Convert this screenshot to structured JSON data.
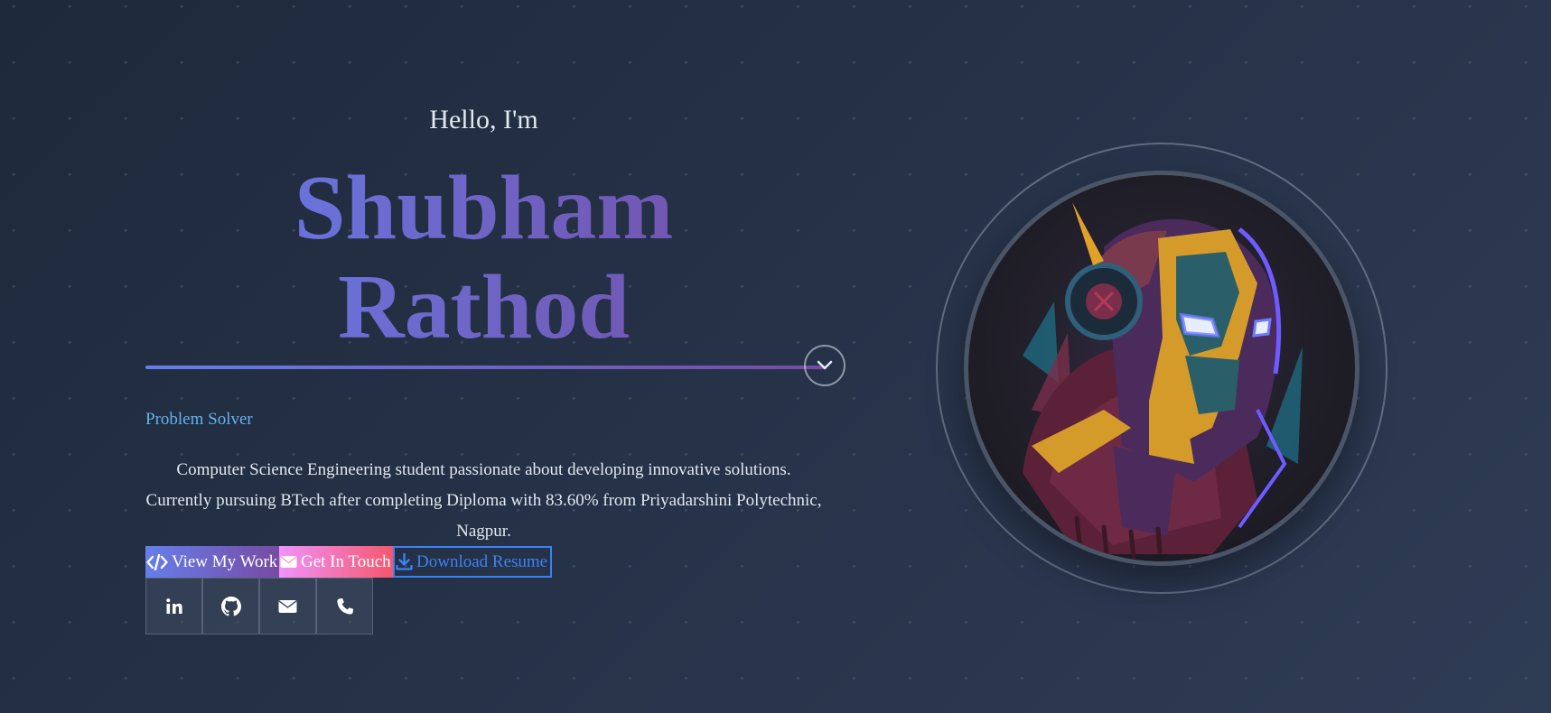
{
  "hero": {
    "greeting": "Hello, I'm",
    "first_name": "Shubham",
    "last_name": "Rathod",
    "role": "Problem Solver",
    "description": "Computer Science Engineering student passionate about developing innovative solutions. Currently pursuing BTech after completing Diploma with 83.60% from Priyadarshini Polytechnic, Nagpur."
  },
  "buttons": {
    "view_work": "View My Work",
    "get_in_touch": "Get In Touch",
    "download_resume": "Download Resume"
  },
  "icons": {
    "scroll": "chevron-down-icon",
    "view_work": "code-icon",
    "get_in_touch": "envelope-icon",
    "download_resume": "download-icon",
    "socials": [
      "linkedin-icon",
      "github-icon",
      "envelope-icon",
      "phone-icon"
    ]
  },
  "colors": {
    "gradient_primary": [
      "#667eea",
      "#764ba2"
    ],
    "gradient_secondary": [
      "#f093fb",
      "#f5576c"
    ],
    "accent_blue": "#3b82f6",
    "role_color": "#63b3ed"
  }
}
